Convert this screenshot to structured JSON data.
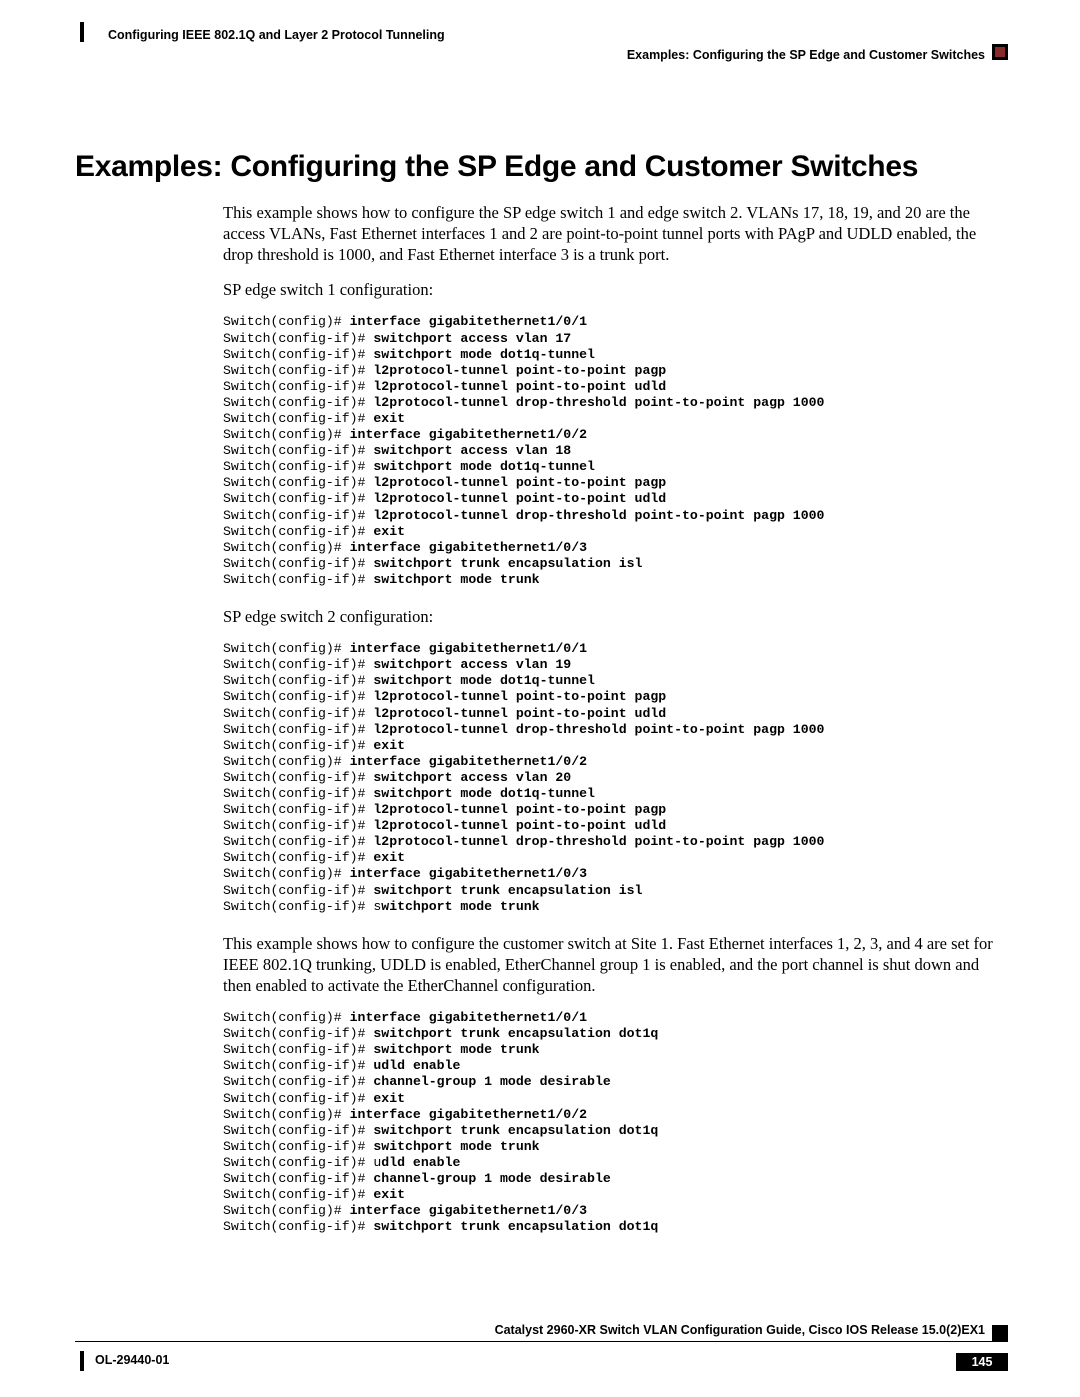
{
  "header": {
    "left": "Configuring IEEE 802.1Q and Layer 2 Protocol Tunneling",
    "right": "Examples: Configuring the SP Edge and Customer Switches"
  },
  "title": "Examples: Configuring the SP Edge and Customer Switches",
  "paragraphs": {
    "intro": "This example shows how to configure the SP edge switch 1 and edge switch 2. VLANs 17, 18, 19, and 20 are the access VLANs, Fast Ethernet interfaces 1 and 2 are point-to-point tunnel ports with PAgP and UDLD enabled, the drop threshold is 1000, and Fast Ethernet interface 3 is a trunk port.",
    "sp1_label": "SP edge switch 1 configuration:",
    "sp2_label": "SP edge switch 2 configuration:",
    "customer_intro": "This example shows how to configure the customer switch at Site 1. Fast Ethernet interfaces 1, 2, 3, and 4 are set for IEEE 802.1Q trunking, UDLD is enabled, EtherChannel group 1 is enabled, and the port channel is shut down and then enabled to activate the EtherChannel configuration."
  },
  "cli": {
    "sp1": [
      {
        "prompt": "Switch(config)# ",
        "cmd": "interface gigabitethernet1/0/1"
      },
      {
        "prompt": "Switch(config-if)# ",
        "cmd": "switchport access vlan 17"
      },
      {
        "prompt": "Switch(config-if)# ",
        "cmd": "switchport mode dot1q-tunnel"
      },
      {
        "prompt": "Switch(config-if)# ",
        "cmd": "l2protocol-tunnel point-to-point pagp"
      },
      {
        "prompt": "Switch(config-if)# ",
        "cmd": "l2protocol-tunnel point-to-point udld"
      },
      {
        "prompt": "Switch(config-if)# ",
        "cmd": "l2protocol-tunnel drop-threshold point-to-point pagp 1000"
      },
      {
        "prompt": "Switch(config-if)# ",
        "cmd": "exit"
      },
      {
        "prompt": "Switch(config)# ",
        "cmd": "interface gigabitethernet1/0/2"
      },
      {
        "prompt": "Switch(config-if)# ",
        "cmd": "switchport access vlan 18"
      },
      {
        "prompt": "Switch(config-if)# ",
        "cmd": "switchport mode dot1q-tunnel"
      },
      {
        "prompt": "Switch(config-if)# ",
        "cmd": "l2protocol-tunnel point-to-point pagp"
      },
      {
        "prompt": "Switch(config-if)# ",
        "cmd": "l2protocol-tunnel point-to-point udld"
      },
      {
        "prompt": "Switch(config-if)# ",
        "cmd": "l2protocol-tunnel drop-threshold point-to-point pagp 1000"
      },
      {
        "prompt": "Switch(config-if)# ",
        "cmd": "exit"
      },
      {
        "prompt": "Switch(config)# ",
        "cmd": "interface gigabitethernet1/0/3"
      },
      {
        "prompt": "Switch(config-if)# ",
        "cmd": "switchport trunk encapsulation isl"
      },
      {
        "prompt": "Switch(config-if)# ",
        "cmd": "switchport mode trunk"
      }
    ],
    "sp2": [
      {
        "prompt": "Switch(config)# ",
        "cmd": "interface gigabitethernet1/0/1"
      },
      {
        "prompt": "Switch(config-if)# ",
        "cmd": "switchport access vlan 19"
      },
      {
        "prompt": "Switch(config-if)# ",
        "cmd": "switchport mode dot1q-tunnel"
      },
      {
        "prompt": "Switch(config-if)# ",
        "cmd": "l2protocol-tunnel point-to-point pagp"
      },
      {
        "prompt": "Switch(config-if)# ",
        "cmd": "l2protocol-tunnel point-to-point udld"
      },
      {
        "prompt": "Switch(config-if)# ",
        "cmd": "l2protocol-tunnel drop-threshold point-to-point pagp 1000"
      },
      {
        "prompt": "Switch(config-if)# ",
        "cmd": "exit"
      },
      {
        "prompt": "Switch(config)# ",
        "cmd": "interface gigabitethernet1/0/2"
      },
      {
        "prompt": "Switch(config-if)# ",
        "cmd": "switchport access vlan 20"
      },
      {
        "prompt": "Switch(config-if)# ",
        "cmd": "switchport mode dot1q-tunnel"
      },
      {
        "prompt": "Switch(config-if)# ",
        "cmd": "l2protocol-tunnel point-to-point pagp"
      },
      {
        "prompt": "Switch(config-if)# ",
        "cmd": "l2protocol-tunnel point-to-point udld"
      },
      {
        "prompt": "Switch(config-if)# ",
        "cmd": "l2protocol-tunnel drop-threshold point-to-point pagp 1000"
      },
      {
        "prompt": "Switch(config-if)# ",
        "cmd": "exit"
      },
      {
        "prompt": "Switch(config)# ",
        "cmd": "interface gigabitethernet1/0/3"
      },
      {
        "prompt": "Switch(config-if)# ",
        "cmd": "switchport trunk encapsulation isl"
      },
      {
        "prompt": "Switch(config-if)# s",
        "cmd": "witchport mode trunk"
      }
    ],
    "customer": [
      {
        "prompt": "Switch(config)# ",
        "cmd": "interface gigabitethernet1/0/1"
      },
      {
        "prompt": "Switch(config-if)# ",
        "cmd": "switchport trunk encapsulation dot1q"
      },
      {
        "prompt": "Switch(config-if)# ",
        "cmd": "switchport mode trunk"
      },
      {
        "prompt": "Switch(config-if)# ",
        "cmd": "udld enable"
      },
      {
        "prompt": "Switch(config-if)# ",
        "cmd": "channel-group 1 mode desirable"
      },
      {
        "prompt": "Switch(config-if)# ",
        "cmd": "exit"
      },
      {
        "prompt": "Switch(config)# ",
        "cmd": "interface gigabitethernet1/0/2"
      },
      {
        "prompt": "Switch(config-if)# ",
        "cmd": "switchport trunk encapsulation dot1q"
      },
      {
        "prompt": "Switch(config-if)# ",
        "cmd": "switchport mode trunk"
      },
      {
        "prompt": "Switch(config-if)# u",
        "cmd": "dld enable"
      },
      {
        "prompt": "Switch(config-if)# ",
        "cmd": "channel-group 1 mode desirable"
      },
      {
        "prompt": "Switch(config-if)# ",
        "cmd": "exit"
      },
      {
        "prompt": "Switch(config)# ",
        "cmd": "interface gigabitethernet1/0/3"
      },
      {
        "prompt": "Switch(config-if)# ",
        "cmd": "switchport trunk encapsulation dot1q"
      }
    ]
  },
  "footer": {
    "book_title": "Catalyst 2960-XR Switch VLAN Configuration Guide, Cisco IOS Release 15.0(2)EX1",
    "doc_id": "OL-29440-01",
    "page": "145"
  }
}
